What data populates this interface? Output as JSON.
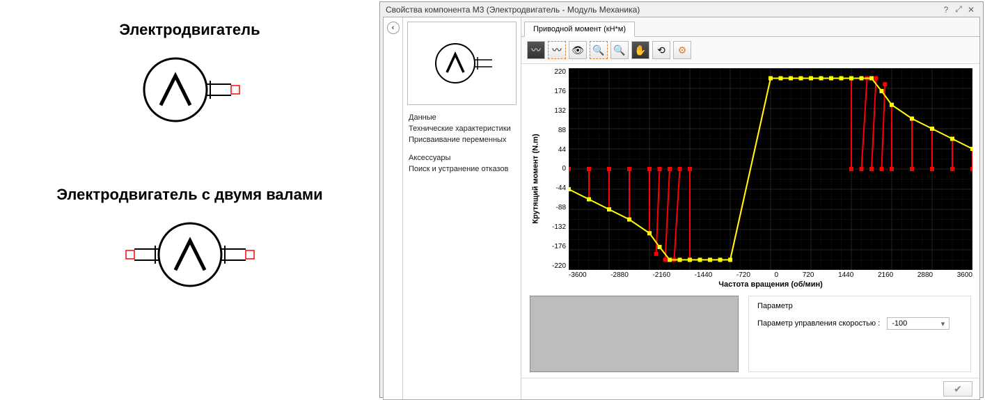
{
  "left": {
    "symbol1_title": "Электродвигатель",
    "symbol2_title": "Электродвигатель с двумя валами"
  },
  "dialog": {
    "title": "Свойства компонента M3 (Электродвигатель - Модуль Механика)"
  },
  "nav": {
    "item1": "Данные",
    "item2": "Технические характеристики",
    "item3": "Присваивание переменных",
    "item4": "Аксессуары",
    "item5": "Поиск и устранение отказов"
  },
  "tab": {
    "label": "Приводной момент (кН*м)"
  },
  "param": {
    "group_title": "Параметр",
    "label": "Параметр управления скоростью :",
    "value": "-100"
  },
  "chart_data": {
    "type": "line",
    "title": "",
    "xlabel": "Частота вращения (об/мин)",
    "ylabel": "Крутящий момент (N.m)",
    "xlim": [
      -3600,
      3600
    ],
    "ylim": [
      -220,
      220
    ],
    "xticks": [
      -3600,
      -2880,
      -2160,
      -1440,
      -720,
      0,
      720,
      1440,
      2160,
      2880,
      3600
    ],
    "yticks": [
      220,
      176,
      132,
      88,
      44,
      0,
      -44,
      -88,
      -132,
      -176,
      -220
    ],
    "series": [
      {
        "name": "yellow",
        "color": "#ffff00",
        "points": [
          [
            -3600,
            -44
          ],
          [
            -3240,
            -66
          ],
          [
            -2880,
            -88
          ],
          [
            -2520,
            -110
          ],
          [
            -2160,
            -140
          ],
          [
            -1980,
            -170
          ],
          [
            -1800,
            -198
          ],
          [
            -1620,
            -198
          ],
          [
            -1440,
            -198
          ],
          [
            -1260,
            -198
          ],
          [
            -1080,
            -198
          ],
          [
            -900,
            -198
          ],
          [
            -720,
            -198
          ],
          [
            0,
            198
          ],
          [
            180,
            198
          ],
          [
            360,
            198
          ],
          [
            540,
            198
          ],
          [
            720,
            198
          ],
          [
            900,
            198
          ],
          [
            1080,
            198
          ],
          [
            1260,
            198
          ],
          [
            1440,
            198
          ],
          [
            1620,
            198
          ],
          [
            1800,
            198
          ],
          [
            1980,
            170
          ],
          [
            2160,
            140
          ],
          [
            2520,
            110
          ],
          [
            2880,
            88
          ],
          [
            3240,
            66
          ],
          [
            3600,
            44
          ]
        ]
      },
      {
        "name": "red",
        "color": "#ff0000",
        "segments": [
          [
            [
              -3600,
              0
            ],
            [
              -3600,
              -44
            ]
          ],
          [
            [
              -3240,
              0
            ],
            [
              -3240,
              -66
            ]
          ],
          [
            [
              -2880,
              0
            ],
            [
              -2880,
              -88
            ]
          ],
          [
            [
              -2520,
              0
            ],
            [
              -2520,
              -110
            ]
          ],
          [
            [
              -2160,
              0
            ],
            [
              -2160,
              -140
            ]
          ],
          [
            [
              -1980,
              0
            ],
            [
              -2040,
              -185
            ]
          ],
          [
            [
              -1800,
              0
            ],
            [
              -1880,
              -198
            ]
          ],
          [
            [
              -1620,
              0
            ],
            [
              -1720,
              -198
            ]
          ],
          [
            [
              -1440,
              0
            ],
            [
              -1440,
              -198
            ]
          ],
          [
            [
              -1260,
              -198
            ],
            [
              -1260,
              -198
            ]
          ],
          [
            [
              -1080,
              -198
            ],
            [
              -1080,
              -198
            ]
          ],
          [
            [
              -900,
              -198
            ],
            [
              -900,
              -198
            ]
          ],
          [
            [
              -720,
              -198
            ],
            [
              -720,
              -198
            ]
          ],
          [
            [
              -720,
              -198
            ],
            [
              0,
              198
            ]
          ],
          [
            [
              180,
              198
            ],
            [
              180,
              198
            ]
          ],
          [
            [
              360,
              198
            ],
            [
              360,
              198
            ]
          ],
          [
            [
              540,
              198
            ],
            [
              540,
              198
            ]
          ],
          [
            [
              720,
              198
            ],
            [
              720,
              198
            ]
          ],
          [
            [
              900,
              198
            ],
            [
              900,
              198
            ]
          ],
          [
            [
              1080,
              198
            ],
            [
              1080,
              198
            ]
          ],
          [
            [
              1260,
              198
            ],
            [
              1260,
              198
            ]
          ],
          [
            [
              1440,
              0
            ],
            [
              1440,
              198
            ]
          ],
          [
            [
              1620,
              0
            ],
            [
              1720,
              198
            ]
          ],
          [
            [
              1800,
              0
            ],
            [
              1880,
              198
            ]
          ],
          [
            [
              1980,
              0
            ],
            [
              2040,
              185
            ]
          ],
          [
            [
              2160,
              0
            ],
            [
              2160,
              140
            ]
          ],
          [
            [
              2520,
              0
            ],
            [
              2520,
              110
            ]
          ],
          [
            [
              2880,
              0
            ],
            [
              2880,
              88
            ]
          ],
          [
            [
              3240,
              0
            ],
            [
              3240,
              66
            ]
          ],
          [
            [
              3600,
              0
            ],
            [
              3600,
              44
            ]
          ]
        ]
      }
    ]
  }
}
